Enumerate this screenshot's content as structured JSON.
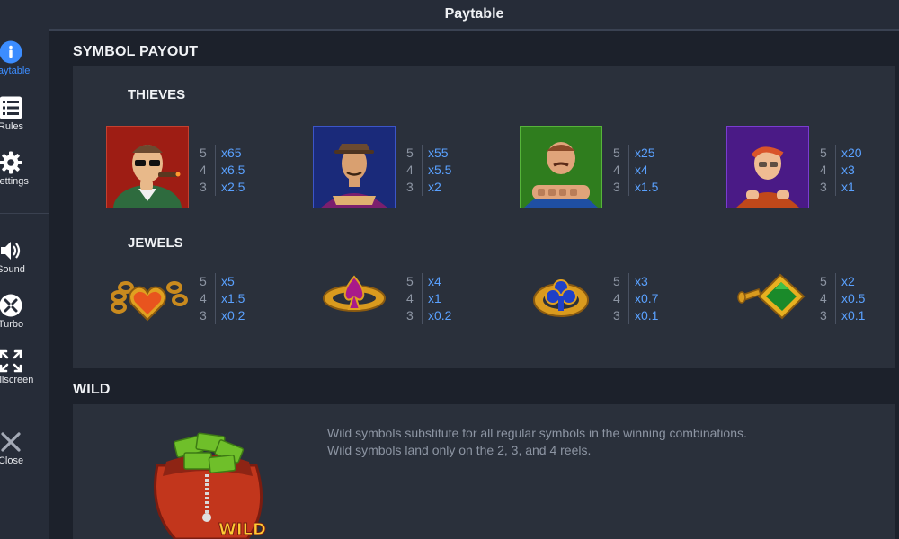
{
  "header": {
    "title": "Paytable"
  },
  "sidebar": {
    "items": [
      {
        "label": "Paytable",
        "icon": "info-icon"
      },
      {
        "label": "Rules",
        "icon": "list-icon"
      },
      {
        "label": "Settings",
        "icon": "gear-icon"
      },
      {
        "label": "Sound",
        "icon": "speaker-icon"
      },
      {
        "label": "Turbo",
        "icon": "turbo-icon"
      },
      {
        "label": "Fullscreen",
        "icon": "fullscreen-icon"
      },
      {
        "label": "Close",
        "icon": "close-icon"
      }
    ]
  },
  "sections": {
    "symbol_payout": "SYMBOL PAYOUT",
    "wild": "WILD"
  },
  "groups": {
    "thieves": "THIEVES",
    "jewels": "JEWELS"
  },
  "thieves": [
    {
      "name": "thief-cigar",
      "counts": [
        "5",
        "4",
        "3"
      ],
      "mults": [
        "x65",
        "x6.5",
        "x2.5"
      ]
    },
    {
      "name": "thief-hat",
      "counts": [
        "5",
        "4",
        "3"
      ],
      "mults": [
        "x55",
        "x5.5",
        "x2"
      ]
    },
    {
      "name": "thief-brute",
      "counts": [
        "5",
        "4",
        "3"
      ],
      "mults": [
        "x25",
        "x4",
        "x1.5"
      ]
    },
    {
      "name": "thief-kid",
      "counts": [
        "5",
        "4",
        "3"
      ],
      "mults": [
        "x20",
        "x3",
        "x1"
      ]
    }
  ],
  "jewels": [
    {
      "name": "heart-jewel",
      "counts": [
        "5",
        "4",
        "3"
      ],
      "mults": [
        "x5",
        "x1.5",
        "x0.2"
      ]
    },
    {
      "name": "spade-ring",
      "counts": [
        "5",
        "4",
        "3"
      ],
      "mults": [
        "x4",
        "x1",
        "x0.2"
      ]
    },
    {
      "name": "club-ring",
      "counts": [
        "5",
        "4",
        "3"
      ],
      "mults": [
        "x3",
        "x0.7",
        "x0.1"
      ]
    },
    {
      "name": "diamond-cufflink",
      "counts": [
        "5",
        "4",
        "3"
      ],
      "mults": [
        "x2",
        "x0.5",
        "x0.1"
      ]
    }
  ],
  "wild": {
    "line1": "Wild symbols substitute for all regular symbols in the winning combinations.",
    "line2": "Wild symbols land only on the 2, 3, and 4 reels.",
    "badge": "WILD"
  },
  "colors": {
    "accent": "#3c8dff",
    "multiplier": "#5aa1ff",
    "panel": "#2a303b",
    "background": "#1c212b"
  }
}
